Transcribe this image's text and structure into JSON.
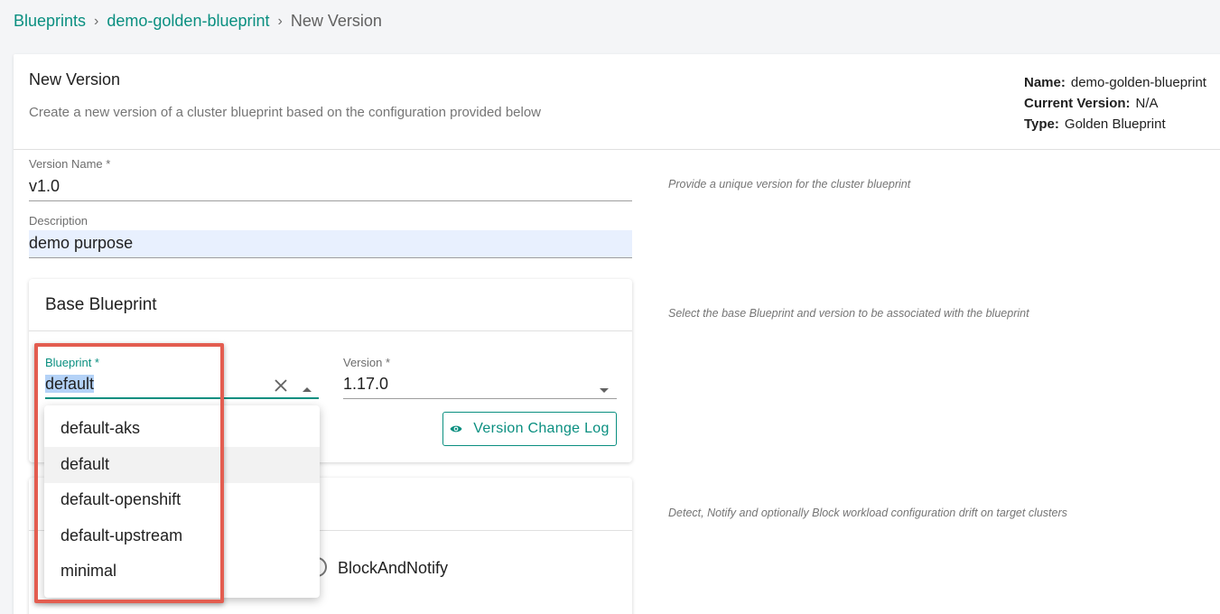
{
  "breadcrumb": {
    "items": [
      "Blueprints",
      "demo-golden-blueprint"
    ],
    "separator": "›",
    "current": "New Version"
  },
  "header": {
    "title": "New Version",
    "subtitle": "Create a new version of a cluster blueprint based on the configuration provided below"
  },
  "meta": {
    "name_label": "Name:",
    "name_value": "demo-golden-blueprint",
    "version_label": "Current Version:",
    "version_value": "N/A",
    "type_label": "Type:",
    "type_value": "Golden Blueprint"
  },
  "form": {
    "version_name": {
      "label": "Version Name *",
      "value": "v1.0",
      "hint": "Provide a unique version for the cluster blueprint"
    },
    "description": {
      "label": "Description",
      "value": "demo purpose"
    }
  },
  "base_blueprint": {
    "title": "Base Blueprint",
    "hint": "Select the base Blueprint and version to be associated with the blueprint",
    "blueprint_label": "Blueprint *",
    "blueprint_value": "default",
    "version_label": "Version *",
    "version_value": "1.17.0",
    "changelog_button": "Version Change Log"
  },
  "drift": {
    "hint": "Detect, Notify and optionally Block workload configuration drift on target clusters",
    "option_label": "BlockAndNotify"
  },
  "dropdown": {
    "options": [
      "default-aks",
      "default",
      "default-openshift",
      "default-upstream",
      "minimal"
    ],
    "selected": "default"
  },
  "colors": {
    "accent": "#0a8f80",
    "highlight_border": "#e35d50",
    "autofill_bg": "#e8f0fe"
  }
}
